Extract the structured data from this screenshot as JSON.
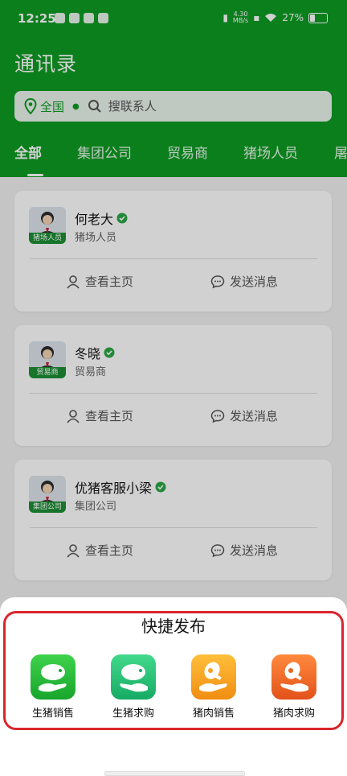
{
  "status_bar": {
    "time": "12:25",
    "speed_top": "4.30",
    "speed_bottom": "MB/s",
    "battery": "27%"
  },
  "header": {
    "title": "通讯录"
  },
  "search": {
    "region": "全国",
    "placeholder": "搜联系人"
  },
  "tabs": [
    {
      "label": "全部",
      "active": true
    },
    {
      "label": "集团公司"
    },
    {
      "label": "贸易商"
    },
    {
      "label": "猪场人员"
    },
    {
      "label": "屠"
    }
  ],
  "contacts": [
    {
      "name": "何老大",
      "role": "猪场人员",
      "tag": "猪场人员",
      "view_label": "查看主页",
      "message_label": "发送消息"
    },
    {
      "name": "冬晓",
      "role": "贸易商",
      "tag": "贸易商",
      "view_label": "查看主页",
      "message_label": "发送消息"
    },
    {
      "name": "优猪客服小梁",
      "role": "集团公司",
      "tag": "集团公司",
      "view_label": "查看主页",
      "message_label": "发送消息"
    }
  ],
  "quick_publish": {
    "title": "快捷发布",
    "items": [
      {
        "label": "生猪销售",
        "icon": "pig-sell-icon",
        "color": "#2ab83a"
      },
      {
        "label": "生猪求购",
        "icon": "pig-buy-icon",
        "color": "#26c07a"
      },
      {
        "label": "猪肉销售",
        "icon": "pork-sell-icon",
        "color": "#f7a21a"
      },
      {
        "label": "猪肉求购",
        "icon": "pork-buy-icon",
        "color": "#f0661e"
      }
    ]
  },
  "colors": {
    "brand": "#0f9c24",
    "highlight_border": "#d9262c",
    "verified": "#2aa845"
  }
}
